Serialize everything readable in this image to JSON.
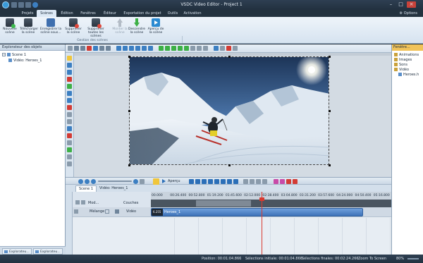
{
  "window": {
    "title": "VSDC Video Editor - Project 1"
  },
  "menu": {
    "tabs": [
      "Projets",
      "Scènes",
      "Édition",
      "Fenêtres",
      "Éditeur",
      "Exportation du projet",
      "Outils",
      "Activation"
    ],
    "options": "Options"
  },
  "ribbon": {
    "buttons": [
      "Nouvelle scène",
      "Télécharger la scène",
      "Enregistrer la scène sous...",
      "Supprimer la scène",
      "Supprimer toutes les scènes",
      "Monter la scène",
      "Descendre la scène",
      "Aperçu de la scène"
    ],
    "group_label": "Gestion des scènes"
  },
  "left_panel": {
    "title": "Explorateur des objets",
    "tree": [
      "Scene 1",
      "Vidéo: Heroes_1"
    ],
    "bottom_tabs": [
      "Explorateu...",
      "Explorateu..."
    ]
  },
  "right_panel": {
    "title": "Fenêtre...",
    "tree": [
      "Animations",
      "Images",
      "Sons",
      "Vidéo",
      "Heroes.h"
    ]
  },
  "timeline": {
    "toolbar_preview": "Aperçu",
    "tabs": [
      "Scene 1",
      "Vidéo: Heroes_1"
    ],
    "columns": [
      "Mod...",
      "Couches"
    ],
    "ruler_ticks": [
      "00.000",
      "00:26.400",
      "00:52.800",
      "01:19.200",
      "01:45.600",
      "02:12.000",
      "02:38.400",
      "03:04.800",
      "03:31.200",
      "03:57.600",
      "04:24.000",
      "04:50.400",
      "05:16.800"
    ],
    "track": {
      "blend": "Mélange",
      "type": "Vidéo"
    },
    "clip": {
      "name": "Heroes_1",
      "thumb_label": "6.255"
    }
  },
  "status": {
    "position": "Position: 00:01:04.866",
    "sel_start": "Sélections initiale: 00:01:04.866",
    "sel_end": "Sélections finales: 00:02:24.266",
    "zoom_label": "Zoom To Screen",
    "zoom": "80%"
  },
  "colors": {
    "accent": "#2b8ad1",
    "clip": "#4f82c6",
    "playhead": "#d93a30",
    "panel_head_active": "#f1c35a"
  }
}
